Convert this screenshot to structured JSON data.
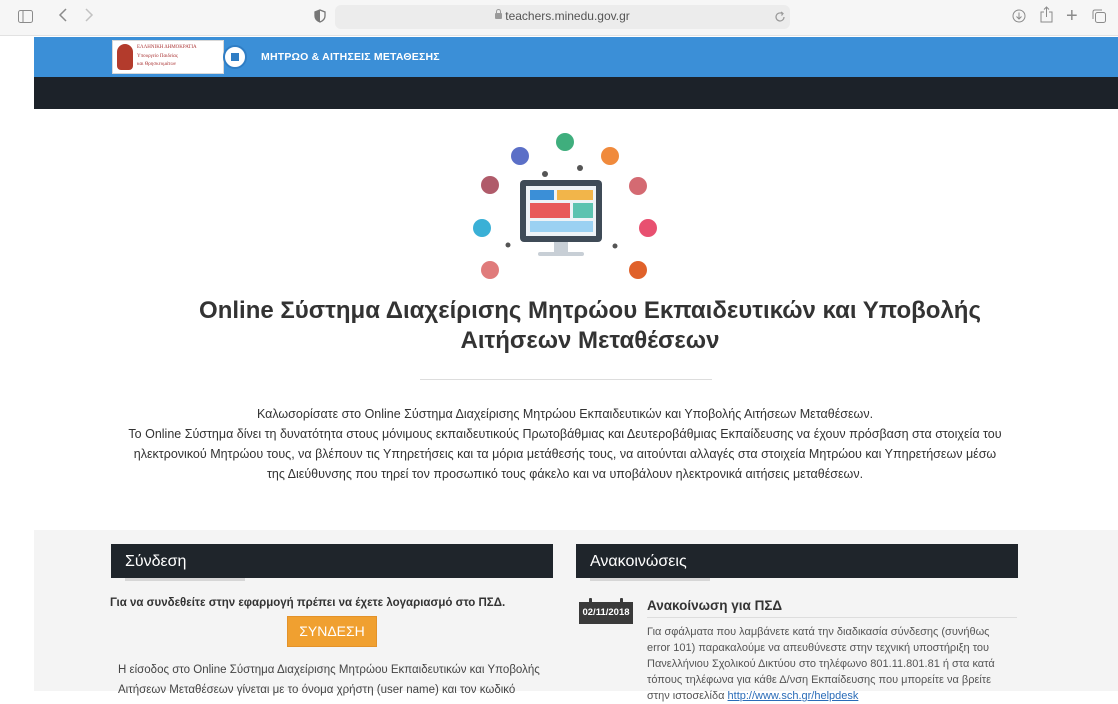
{
  "browser": {
    "url": "teachers.minedu.gov.gr",
    "sidebar_icon": "sidebar-icon",
    "back_icon": "back-icon",
    "forward_icon": "forward-icon",
    "reload_icon": "reload-icon",
    "download_icon": "download-icon",
    "share_icon": "share-icon",
    "new_tab_icon": "plus-icon",
    "tabs_icon": "tabs-icon"
  },
  "header": {
    "logo_lines": [
      "ΕΛΛΗΝΙΚΗ ΔΗΜΟΚΡΑΤΙΑ",
      "Υπουργείο Παιδείας",
      "και Θρησκευμάτων"
    ],
    "title": "ΜΗΤΡΩΟ & ΑΙΤΗΣΕΙΣ ΜΕΤΑΘΕΣΗΣ",
    "brand_color": "#3b8fd7",
    "nav_color": "#1c2229"
  },
  "hero": {
    "title_line1": "Online Σύστημα Διαχείρισης Μητρώου Εκπαιδευτικών και Υποβολής",
    "title_line2": "Αιτήσεων Μεταθέσεων",
    "intro_line1": "Καλωσορίσατε στο Online Σύστημα Διαχείρισης Μητρώου Εκπαιδευτικών και Υποβολής Αιτήσεων Μεταθέσεων.",
    "intro_line2": "Το Online Σύστημα δίνει τη δυνατότητα στους μόνιμους εκπαιδευτικούς Πρωτοβάθμιας και Δευτεροβάθμιας Εκπαίδευσης να έχουν πρόσβαση στα στοιχεία του",
    "intro_line3": "ηλεκτρονικού Μητρώου τους, να βλέπουν τις Υπηρετήσεις και τα μόρια μετάθεσής τους, να αιτούνται αλλαγές στα στοιχεία Μητρώου και Υπηρετήσεων μέσω",
    "intro_line4": "της Διεύθυνσης που τηρεί τον προσωπικό τους φάκελο και να υποβάλουν ηλεκτρονικά αιτήσεις μεταθέσεων."
  },
  "login": {
    "heading": "Σύνδεση",
    "note": "Για να συνδεθείτε στην εφαρμογή πρέπει να έχετε λογαριασμό στο ΠΣΔ.",
    "button": "ΣΥΝΔΕΣΗ",
    "button_color": "#f0a030",
    "text_line1": "Η είσοδος στο Online Σύστημα Διαχείρισης Μητρώου Εκπαιδευτικών και Υποβολής",
    "text_line2": "Αιτήσεων Μεταθέσεων γίνεται με το όνομα χρήστη (user name) και τον κωδικό"
  },
  "announcements": {
    "heading": "Ανακοινώσεις",
    "items": [
      {
        "date": "02/11/2018",
        "title": "Ανακοίνωση για ΠΣΔ",
        "text_line1": "Για σφάλματα που λαμβάνετε κατά την διαδικασία σύνδεσης (συνήθως",
        "text_line2": "error 101) παρακαλούμε να απευθύνεστε στην τεχνική υποστήριξη του",
        "text_line3": "Πανελλήνιου Σχολικού Δικτύου στο τηλέφωνο 801.11.801.81 ή στα κατά",
        "text_line4": "τόπους τηλέφωνα για κάθε Δ/νση Εκπαίδευσης που μπορείτε να βρείτε",
        "text_line5_prefix": "στην ιστοσελίδα",
        "link": "http://www.sch.gr/helpdesk"
      }
    ]
  }
}
